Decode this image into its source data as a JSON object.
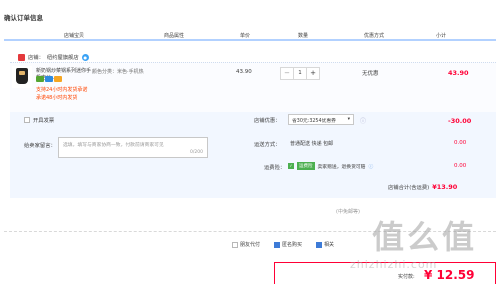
{
  "page": {
    "title": "确认订单信息"
  },
  "headers": [
    "店铺宝贝",
    "商品属性",
    "单价",
    "数量",
    "优惠方式",
    "小计"
  ],
  "shop": {
    "label": "店铺：",
    "name": "纽约屋旗舰店"
  },
  "product": {
    "name": "新奶锅炒菜锅系列迷你手机电炒...",
    "attr": "颜色分类：米色·手机热",
    "price": "43.90",
    "qty": "1",
    "discount": "无优惠",
    "subtotal": "43.90",
    "note1": "支持24小时内发货承诺",
    "note2": "承诺48小时内发货"
  },
  "options": {
    "invoice": "开具发票",
    "message_label": "给卖家留言：",
    "message_placeholder": "选填，填写与商家协商一致，付款前请商家可见",
    "message_count": "0/200",
    "shop_discount_label": "店铺优惠：",
    "shop_discount_select": "省30元:3254优惠券",
    "shop_discount_amt": "-30.00",
    "ship_label": "运送方式：",
    "ship_value": "普通配送 快递 包邮",
    "ship_amt": "0.00",
    "insurance_label": "运费险：",
    "insurance_tag": "运费险",
    "insurance_text": "卖家赠送，退换货可赔",
    "insurance_amt": "0.00",
    "store_total_label": "店铺合计(含运费)",
    "store_total": "¥13.90"
  },
  "helpline": "(中免邮等)",
  "pay": {
    "anon": "匿名购买",
    "friend": "朋友代付",
    "other": "相关"
  },
  "final": {
    "label": "实付款:",
    "amount": "¥ 12.59"
  },
  "watermark": {
    "big": "值么值",
    "small": "zhizhizhi.com"
  },
  "colors": {
    "accent": "#ff0036",
    "header_rule": "#b2d1ff",
    "panel": "#f2f7ff"
  }
}
